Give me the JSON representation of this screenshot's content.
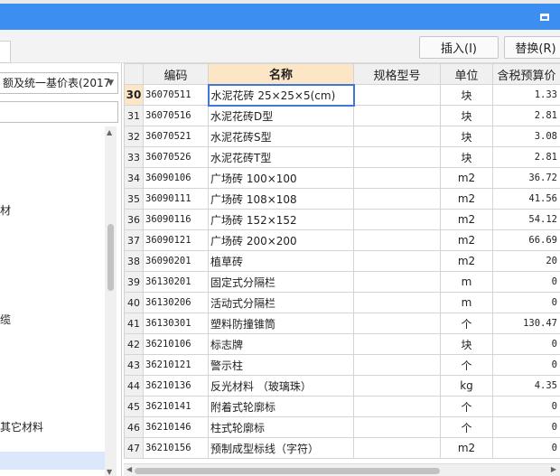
{
  "toolbar": {
    "insert_label": "插入(I)",
    "replace_label": "替换(R)"
  },
  "left_panel": {
    "combo_value": "额及统一基价表(2017",
    "tree_labels": [
      "材",
      "缆",
      "其它材料"
    ]
  },
  "table": {
    "headers": {
      "code": "编码",
      "name": "名称",
      "spec": "规格型号",
      "unit": "单位",
      "price": "含税预算价"
    },
    "rows": [
      {
        "n": "30",
        "code": "36070511",
        "name": "水泥花砖 25×25×5(cm)",
        "spec": "",
        "unit": "块",
        "price": "1.33"
      },
      {
        "n": "31",
        "code": "36070516",
        "name": "水泥花砖D型",
        "spec": "",
        "unit": "块",
        "price": "2.81"
      },
      {
        "n": "32",
        "code": "36070521",
        "name": "水泥花砖S型",
        "spec": "",
        "unit": "块",
        "price": "3.08"
      },
      {
        "n": "33",
        "code": "36070526",
        "name": "水泥花砖T型",
        "spec": "",
        "unit": "块",
        "price": "2.81"
      },
      {
        "n": "34",
        "code": "36090106",
        "name": "广场砖 100×100",
        "spec": "",
        "unit": "m2",
        "price": "36.72"
      },
      {
        "n": "35",
        "code": "36090111",
        "name": "广场砖 108×108",
        "spec": "",
        "unit": "m2",
        "price": "41.56"
      },
      {
        "n": "36",
        "code": "36090116",
        "name": "广场砖 152×152",
        "spec": "",
        "unit": "m2",
        "price": "54.12"
      },
      {
        "n": "37",
        "code": "36090121",
        "name": "广场砖 200×200",
        "spec": "",
        "unit": "m2",
        "price": "66.69"
      },
      {
        "n": "38",
        "code": "36090201",
        "name": "植草砖",
        "spec": "",
        "unit": "m2",
        "price": "20"
      },
      {
        "n": "39",
        "code": "36130201",
        "name": "固定式分隔栏",
        "spec": "",
        "unit": "m",
        "price": "0"
      },
      {
        "n": "40",
        "code": "36130206",
        "name": "活动式分隔栏",
        "spec": "",
        "unit": "m",
        "price": "0"
      },
      {
        "n": "41",
        "code": "36130301",
        "name": "塑料防撞锥筒",
        "spec": "",
        "unit": "个",
        "price": "130.47"
      },
      {
        "n": "42",
        "code": "36210106",
        "name": "标志牌",
        "spec": "",
        "unit": "块",
        "price": "0"
      },
      {
        "n": "43",
        "code": "36210121",
        "name": "警示柱",
        "spec": "",
        "unit": "个",
        "price": "0"
      },
      {
        "n": "44",
        "code": "36210136",
        "name": "反光材料 （玻璃珠）",
        "spec": "",
        "unit": "kg",
        "price": "4.35"
      },
      {
        "n": "45",
        "code": "36210141",
        "name": "附着式轮廓标",
        "spec": "",
        "unit": "个",
        "price": "0"
      },
      {
        "n": "46",
        "code": "36210146",
        "name": "柱式轮廓标",
        "spec": "",
        "unit": "个",
        "price": "0"
      },
      {
        "n": "47",
        "code": "36210156",
        "name": "预制成型标线（字符）",
        "spec": "",
        "unit": "m2",
        "price": "0"
      }
    ],
    "active_row": "30"
  },
  "colors": {
    "titlebar": "#3c8ff0",
    "header_highlight": "#fce6c6",
    "selection_border": "#3c78d8"
  }
}
